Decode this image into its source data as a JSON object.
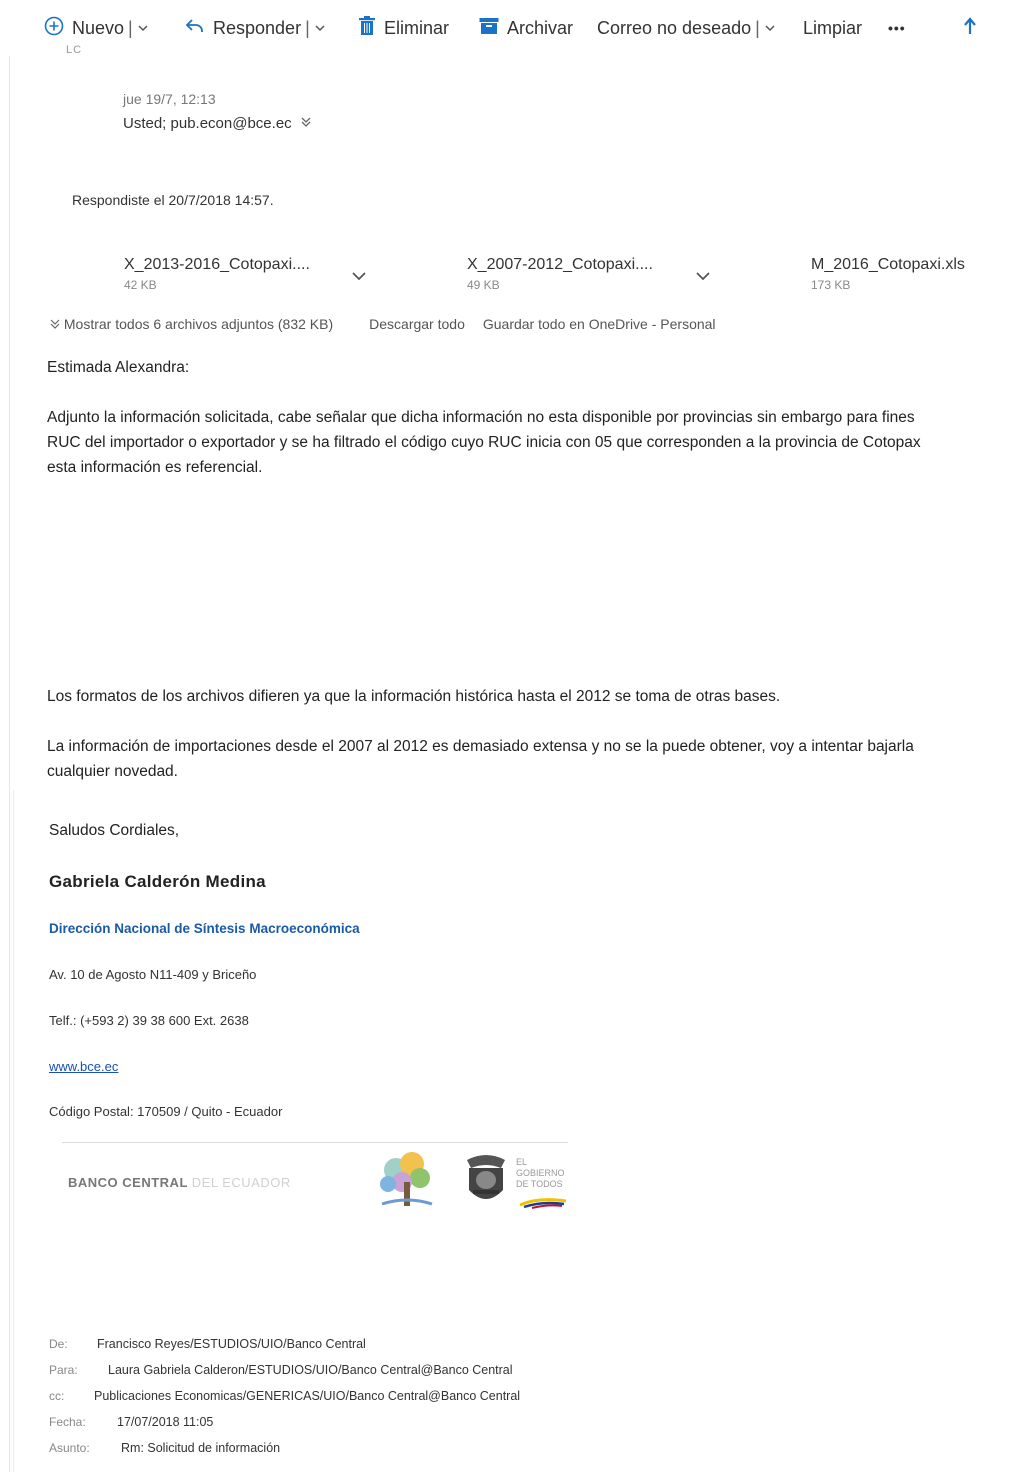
{
  "toolbar": {
    "new_label": "Nuevo",
    "reply_label": "Responder",
    "delete_label": "Eliminar",
    "archive_label": "Archivar",
    "junk_label": "Correo no deseado",
    "sweep_label": "Limpiar",
    "more_label": "•••",
    "accent": "#1a73c8"
  },
  "message": {
    "cut_initials": "LC",
    "date": "jue 19/7, 12:13",
    "recipients": "Usted; pub.econ@bce.ec",
    "replied_notice": "Respondiste el 20/7/2018 14:57."
  },
  "attachments": {
    "items": [
      {
        "name": "X_2013-2016_Cotopaxi....",
        "size": "42 KB"
      },
      {
        "name": "X_2007-2012_Cotopaxi....",
        "size": "49 KB"
      },
      {
        "name": "M_2016_Cotopaxi.xls",
        "size": "173 KB"
      }
    ],
    "show_all": "Mostrar todos 6 archivos adjuntos (832 KB)",
    "download_all": "Descargar todo",
    "save_onedrive": "Guardar todo en OneDrive - Personal"
  },
  "body": {
    "greeting": "Estimada Alexandra:",
    "p1_l1": "Adjunto la información solicitada, cabe señalar que dicha información no esta disponible por provincias sin embargo para fines",
    "p1_l2": "RUC del importador o exportador y se ha filtrado el código cuyo RUC inicia con 05 que corresponden a la provincia de Cotopax",
    "p1_l3": "esta información es referencial.",
    "p2": "Los formatos de los archivos difieren ya que la información histórica hasta el 2012 se toma de otras bases.",
    "p3_l1": "La información de importaciones desde el 2007 al 2012 es demasiado extensa y no se la puede obtener, voy a intentar bajarla",
    "p3_l2": "cualquier novedad.",
    "closing": "Saludos Cordiales,"
  },
  "signature": {
    "name": "Gabriela Calderón Medina",
    "department": "Dirección Nacional de Síntesis Macroeconómica",
    "address": "Av. 10 de Agosto N11-409 y Briceño",
    "phone": "Telf.: (+593 2) 39 38 600 Ext. 2638",
    "website": "www.bce.ec",
    "postal": "Código Postal: 170509 / Quito - Ecuador",
    "logo_main": "BANCO CENTRAL",
    "logo_faded": "DEL ECUADOR",
    "gov_logo_text": "EL GOBIERNO DE TODOS",
    "dept_color": "#1b5aa6"
  },
  "forwarded": {
    "from_label": "De:",
    "from_value": "Francisco Reyes/ESTUDIOS/UIO/Banco Central",
    "to_label": "Para:",
    "to_value": "Laura Gabriela Calderon/ESTUDIOS/UIO/Banco Central@Banco Central",
    "cc_label": "cc:",
    "cc_value": "Publicaciones Economicas/GENERICAS/UIO/Banco Central@Banco Central",
    "date_label": "Fecha:",
    "date_value": "17/07/2018 11:05",
    "subject_label": "Asunto:",
    "subject_value": "Rm: Solicitud de información"
  }
}
